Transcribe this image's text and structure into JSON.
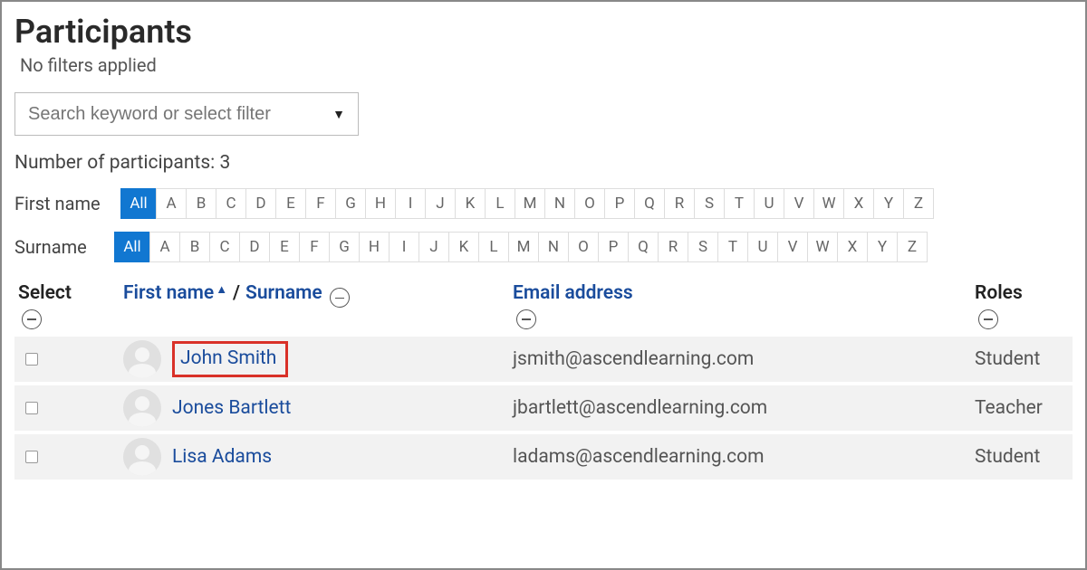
{
  "header": {
    "title": "Participants",
    "filter_status": "No filters applied"
  },
  "search": {
    "placeholder": "Search keyword or select filter"
  },
  "count": {
    "label": "Number of participants: 3"
  },
  "letter_filters": {
    "firstname_label": "First name",
    "surname_label": "Surname",
    "all_label": "All",
    "letters": [
      "A",
      "B",
      "C",
      "D",
      "E",
      "F",
      "G",
      "H",
      "I",
      "J",
      "K",
      "L",
      "M",
      "N",
      "O",
      "P",
      "Q",
      "R",
      "S",
      "T",
      "U",
      "V",
      "W",
      "X",
      "Y",
      "Z"
    ]
  },
  "table": {
    "headers": {
      "select": "Select",
      "firstname": "First name",
      "surname": "Surname",
      "email": "Email address",
      "roles": "Roles"
    },
    "rows": [
      {
        "name": "John Smith",
        "email": "jsmith@ascendlearning.com",
        "role": "Student",
        "highlighted": true
      },
      {
        "name": "Jones Bartlett",
        "email": "jbartlett@ascendlearning.com",
        "role": "Teacher",
        "highlighted": false
      },
      {
        "name": "Lisa Adams",
        "email": "ladams@ascendlearning.com",
        "role": "Student",
        "highlighted": false
      }
    ]
  }
}
